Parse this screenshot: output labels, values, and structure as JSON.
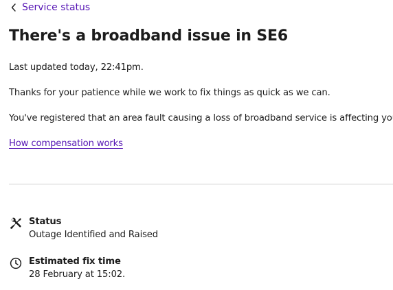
{
  "nav": {
    "back_label": "Service status",
    "back_icon": "chevron-left-icon"
  },
  "page": {
    "title": "There's a broadband issue in SE6",
    "last_updated": "Last updated today, 22:41pm.",
    "thanks": "Thanks for your patience while we work to fix things as quick as we can.",
    "registered": "You've registered that an area fault causing a loss of broadband service is affecting you.",
    "compensation_link": "How compensation works"
  },
  "details": {
    "status": {
      "icon": "tools-icon",
      "label": "Status",
      "value": "Outage Identified and Raised"
    },
    "fix_time": {
      "icon": "clock-icon",
      "label": "Estimated fix time",
      "value": "28 February at 15:02."
    }
  },
  "colors": {
    "accent": "#5514b4",
    "text": "#1c1c1c",
    "divider": "#cfcfcf"
  }
}
